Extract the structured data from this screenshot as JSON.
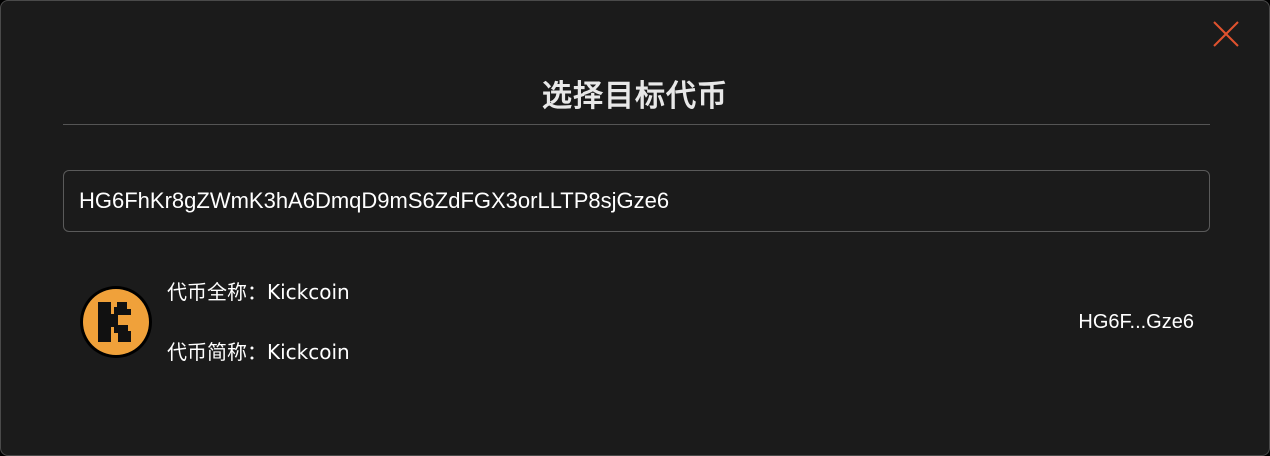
{
  "dialog": {
    "title": "选择目标代币",
    "close_icon": "close-x-icon",
    "close_color": "#e0522e"
  },
  "search": {
    "value": "HG6FhKr8gZWmK3hA6DmqD9mS6ZdFGX3orLLTP8sjGze6"
  },
  "token": {
    "logo_icon": "kickcoin-logo",
    "logo_color": "#f0a13a",
    "full_name_label": "代币全称：",
    "full_name": "Kickcoin",
    "short_name_label": "代币简称：",
    "short_name": "Kickcoin",
    "address_short": "HG6F...Gze6"
  }
}
